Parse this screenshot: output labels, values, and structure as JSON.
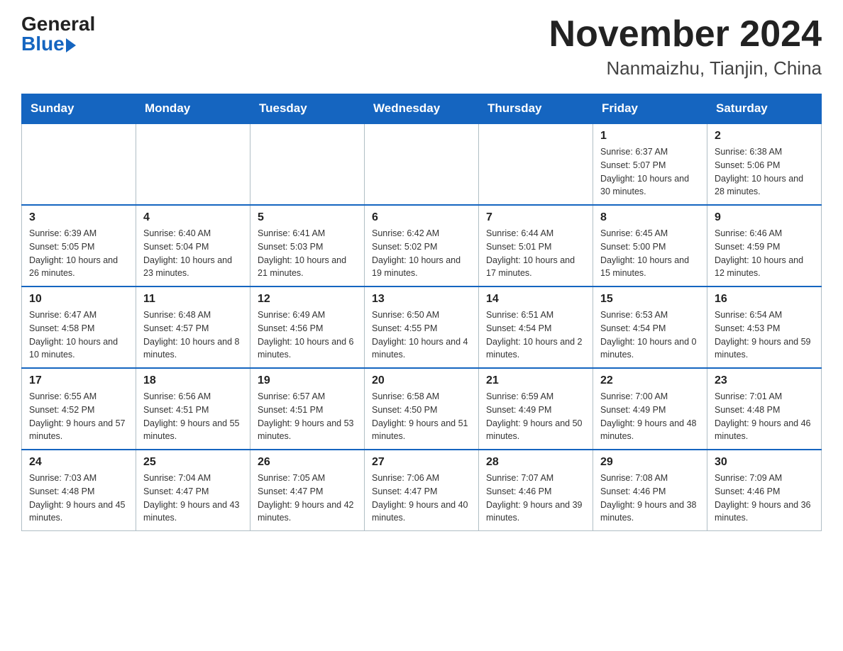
{
  "header": {
    "logo_general": "General",
    "logo_blue": "Blue",
    "month_title": "November 2024",
    "location": "Nanmaizhu, Tianjin, China"
  },
  "weekdays": [
    "Sunday",
    "Monday",
    "Tuesday",
    "Wednesday",
    "Thursday",
    "Friday",
    "Saturday"
  ],
  "weeks": [
    [
      {
        "day": "",
        "info": ""
      },
      {
        "day": "",
        "info": ""
      },
      {
        "day": "",
        "info": ""
      },
      {
        "day": "",
        "info": ""
      },
      {
        "day": "",
        "info": ""
      },
      {
        "day": "1",
        "info": "Sunrise: 6:37 AM\nSunset: 5:07 PM\nDaylight: 10 hours\nand 30 minutes."
      },
      {
        "day": "2",
        "info": "Sunrise: 6:38 AM\nSunset: 5:06 PM\nDaylight: 10 hours\nand 28 minutes."
      }
    ],
    [
      {
        "day": "3",
        "info": "Sunrise: 6:39 AM\nSunset: 5:05 PM\nDaylight: 10 hours\nand 26 minutes."
      },
      {
        "day": "4",
        "info": "Sunrise: 6:40 AM\nSunset: 5:04 PM\nDaylight: 10 hours\nand 23 minutes."
      },
      {
        "day": "5",
        "info": "Sunrise: 6:41 AM\nSunset: 5:03 PM\nDaylight: 10 hours\nand 21 minutes."
      },
      {
        "day": "6",
        "info": "Sunrise: 6:42 AM\nSunset: 5:02 PM\nDaylight: 10 hours\nand 19 minutes."
      },
      {
        "day": "7",
        "info": "Sunrise: 6:44 AM\nSunset: 5:01 PM\nDaylight: 10 hours\nand 17 minutes."
      },
      {
        "day": "8",
        "info": "Sunrise: 6:45 AM\nSunset: 5:00 PM\nDaylight: 10 hours\nand 15 minutes."
      },
      {
        "day": "9",
        "info": "Sunrise: 6:46 AM\nSunset: 4:59 PM\nDaylight: 10 hours\nand 12 minutes."
      }
    ],
    [
      {
        "day": "10",
        "info": "Sunrise: 6:47 AM\nSunset: 4:58 PM\nDaylight: 10 hours\nand 10 minutes."
      },
      {
        "day": "11",
        "info": "Sunrise: 6:48 AM\nSunset: 4:57 PM\nDaylight: 10 hours\nand 8 minutes."
      },
      {
        "day": "12",
        "info": "Sunrise: 6:49 AM\nSunset: 4:56 PM\nDaylight: 10 hours\nand 6 minutes."
      },
      {
        "day": "13",
        "info": "Sunrise: 6:50 AM\nSunset: 4:55 PM\nDaylight: 10 hours\nand 4 minutes."
      },
      {
        "day": "14",
        "info": "Sunrise: 6:51 AM\nSunset: 4:54 PM\nDaylight: 10 hours\nand 2 minutes."
      },
      {
        "day": "15",
        "info": "Sunrise: 6:53 AM\nSunset: 4:54 PM\nDaylight: 10 hours\nand 0 minutes."
      },
      {
        "day": "16",
        "info": "Sunrise: 6:54 AM\nSunset: 4:53 PM\nDaylight: 9 hours\nand 59 minutes."
      }
    ],
    [
      {
        "day": "17",
        "info": "Sunrise: 6:55 AM\nSunset: 4:52 PM\nDaylight: 9 hours\nand 57 minutes."
      },
      {
        "day": "18",
        "info": "Sunrise: 6:56 AM\nSunset: 4:51 PM\nDaylight: 9 hours\nand 55 minutes."
      },
      {
        "day": "19",
        "info": "Sunrise: 6:57 AM\nSunset: 4:51 PM\nDaylight: 9 hours\nand 53 minutes."
      },
      {
        "day": "20",
        "info": "Sunrise: 6:58 AM\nSunset: 4:50 PM\nDaylight: 9 hours\nand 51 minutes."
      },
      {
        "day": "21",
        "info": "Sunrise: 6:59 AM\nSunset: 4:49 PM\nDaylight: 9 hours\nand 50 minutes."
      },
      {
        "day": "22",
        "info": "Sunrise: 7:00 AM\nSunset: 4:49 PM\nDaylight: 9 hours\nand 48 minutes."
      },
      {
        "day": "23",
        "info": "Sunrise: 7:01 AM\nSunset: 4:48 PM\nDaylight: 9 hours\nand 46 minutes."
      }
    ],
    [
      {
        "day": "24",
        "info": "Sunrise: 7:03 AM\nSunset: 4:48 PM\nDaylight: 9 hours\nand 45 minutes."
      },
      {
        "day": "25",
        "info": "Sunrise: 7:04 AM\nSunset: 4:47 PM\nDaylight: 9 hours\nand 43 minutes."
      },
      {
        "day": "26",
        "info": "Sunrise: 7:05 AM\nSunset: 4:47 PM\nDaylight: 9 hours\nand 42 minutes."
      },
      {
        "day": "27",
        "info": "Sunrise: 7:06 AM\nSunset: 4:47 PM\nDaylight: 9 hours\nand 40 minutes."
      },
      {
        "day": "28",
        "info": "Sunrise: 7:07 AM\nSunset: 4:46 PM\nDaylight: 9 hours\nand 39 minutes."
      },
      {
        "day": "29",
        "info": "Sunrise: 7:08 AM\nSunset: 4:46 PM\nDaylight: 9 hours\nand 38 minutes."
      },
      {
        "day": "30",
        "info": "Sunrise: 7:09 AM\nSunset: 4:46 PM\nDaylight: 9 hours\nand 36 minutes."
      }
    ]
  ]
}
